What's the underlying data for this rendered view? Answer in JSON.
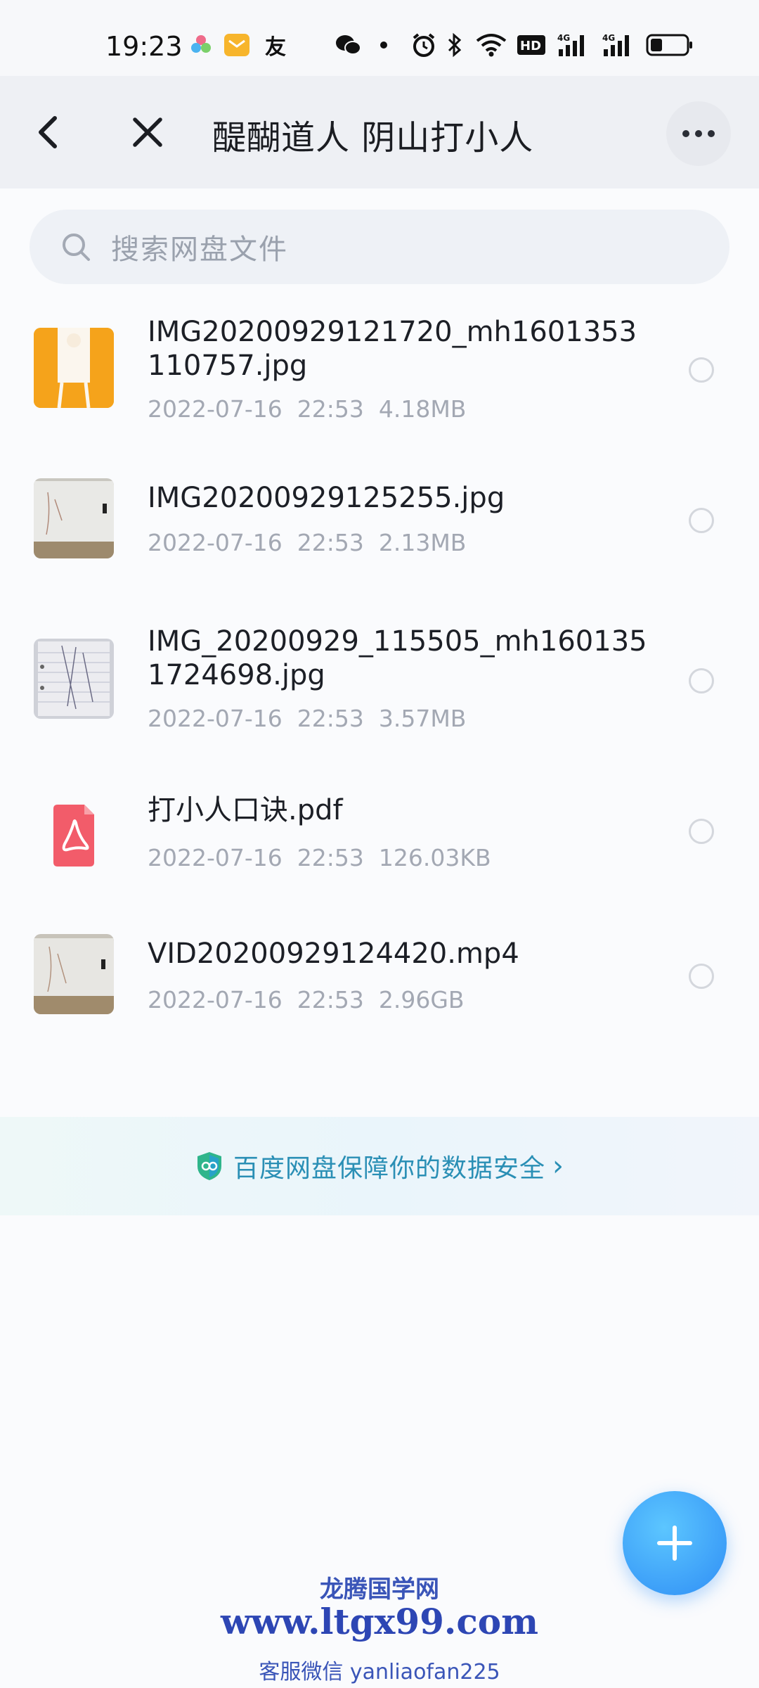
{
  "status_bar": {
    "time": "19:23",
    "icons": [
      "flower-app-icon",
      "mail-app-icon",
      "friend-app-icon",
      "wechat-icon",
      "dot-icon",
      "alarm-icon",
      "bluetooth-icon",
      "wifi-icon",
      "hd-icon",
      "signal-4g-icon",
      "signal-4g-icon",
      "battery-icon"
    ]
  },
  "header": {
    "title": "醍醐道人 阴山打小人"
  },
  "search": {
    "placeholder": "搜索网盘文件"
  },
  "files": [
    {
      "name": "IMG20200929121720_mh1601353110757.jpg",
      "date": "2022-07-16",
      "time": "22:53",
      "size": "4.18MB",
      "type": "image"
    },
    {
      "name": "IMG20200929125255.jpg",
      "date": "2022-07-16",
      "time": "22:53",
      "size": "2.13MB",
      "type": "image"
    },
    {
      "name": "IMG_20200929_115505_mh1601351724698.jpg",
      "date": "2022-07-16",
      "time": "22:53",
      "size": "3.57MB",
      "type": "image"
    },
    {
      "name": "打小人口诀.pdf",
      "date": "2022-07-16",
      "time": "22:53",
      "size": "126.03KB",
      "type": "pdf"
    },
    {
      "name": "VID20200929124420.mp4",
      "date": "2022-07-16",
      "time": "22:53",
      "size": "2.96GB",
      "type": "video"
    }
  ],
  "banner": {
    "text": "百度网盘保障你的数据安全"
  },
  "watermark": {
    "line1": "龙腾国学网",
    "line2": "www.ltgx99.com",
    "line3": "客服微信 yanliaofan225"
  },
  "colors": {
    "accent": "#2f8ef5",
    "banner_text": "#2a8fb5",
    "pdf_icon": "#f25c6a"
  }
}
